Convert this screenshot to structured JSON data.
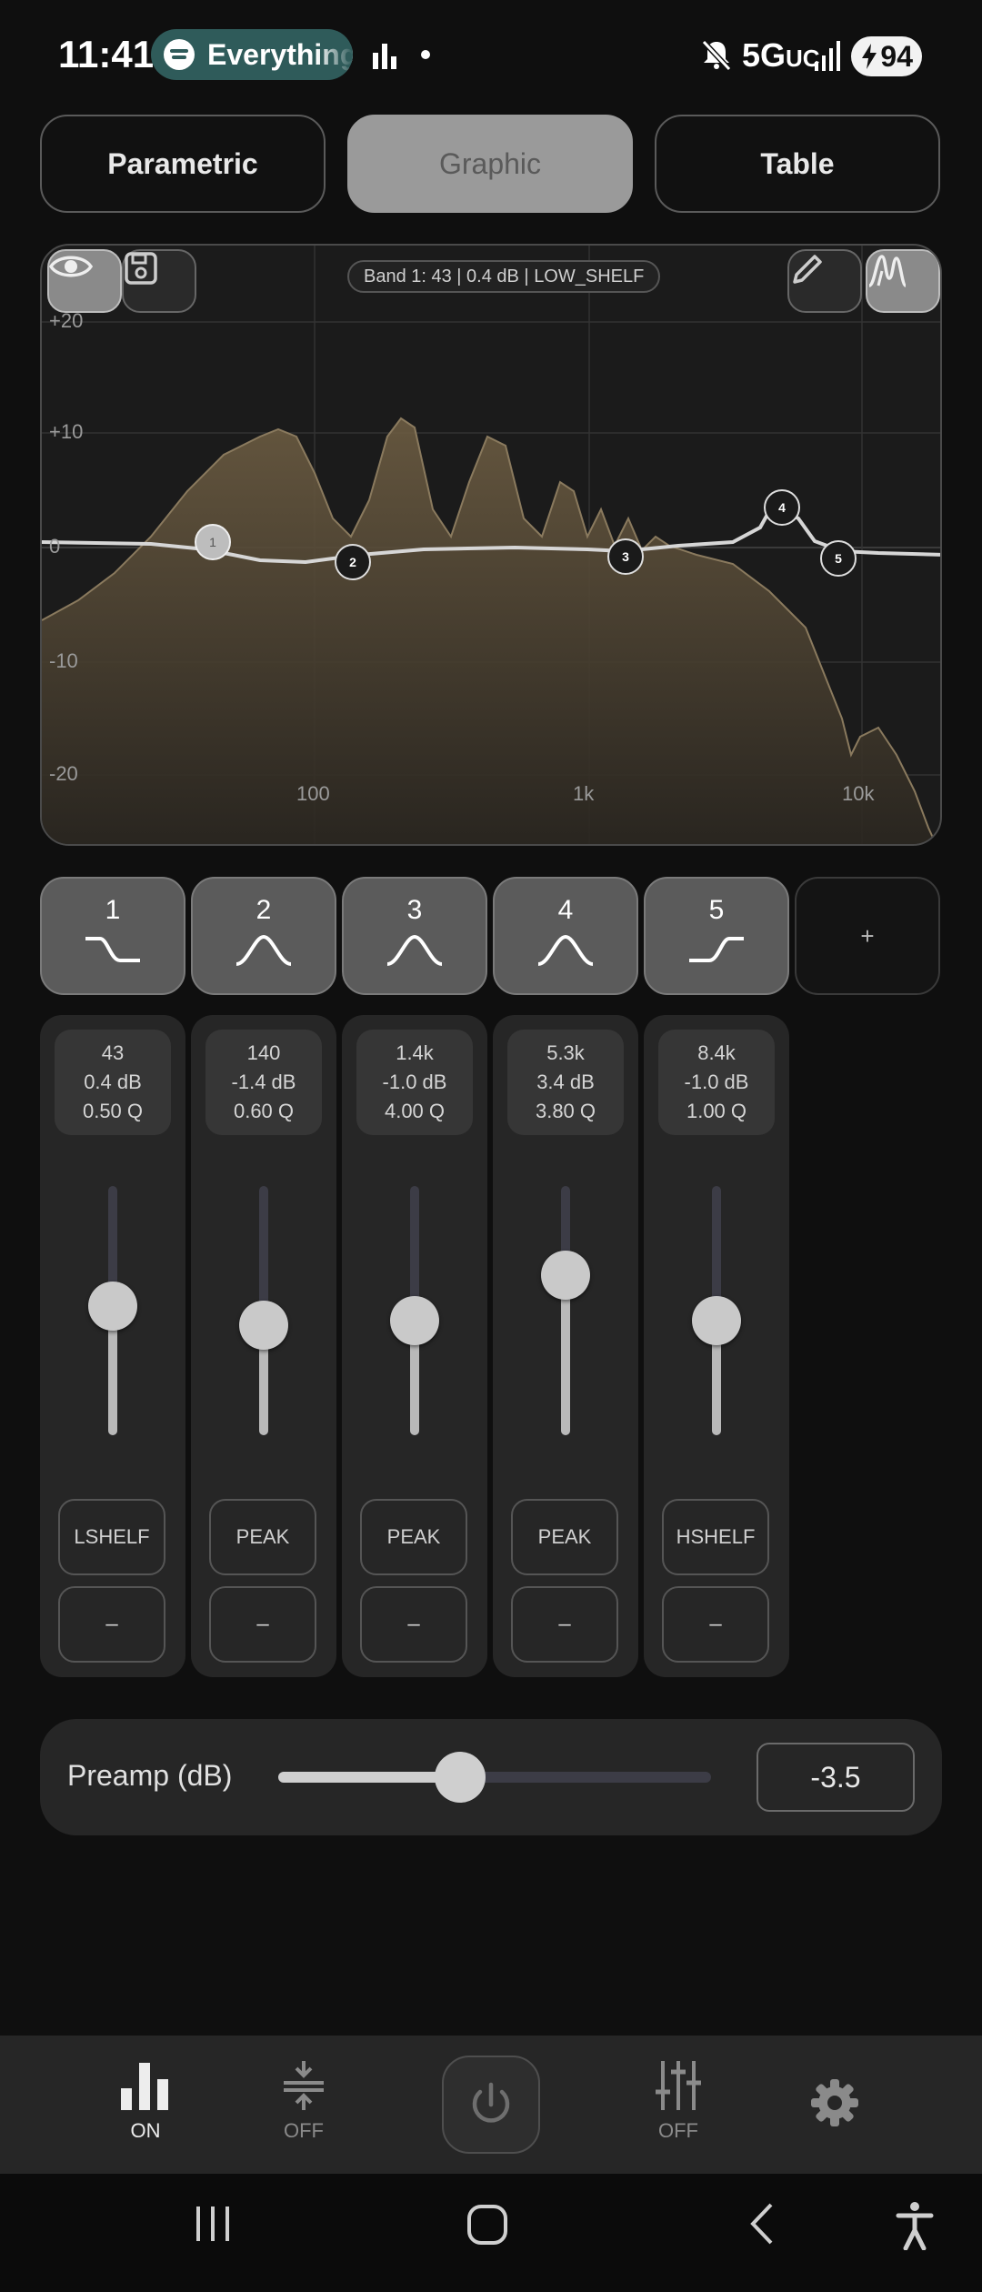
{
  "status_bar": {
    "time": "11:41",
    "now_playing": "Everything",
    "network": "5G",
    "network_suffix": "UC",
    "battery": "94",
    "icons": [
      "spotify-icon",
      "equalizer-status-icon",
      "notification-dot-icon",
      "mute-icon",
      "signal-icon",
      "battery-charging-icon"
    ]
  },
  "mode_tabs": [
    {
      "label": "Parametric",
      "active": false
    },
    {
      "label": "Graphic",
      "active": true
    },
    {
      "label": "Table",
      "active": false
    }
  ],
  "graph": {
    "band_info": "Band 1: 43 | 0.4 dB | LOW_SHELF",
    "y_labels": [
      "+20",
      "+10",
      "0",
      "-10",
      "-20"
    ],
    "x_labels": [
      "100",
      "1k",
      "10k"
    ],
    "buttons": [
      "eye-icon",
      "save-icon",
      "pencil-icon",
      "spectrum-icon"
    ],
    "colors": {
      "response_fill": "#5a4c38",
      "curve": "#d6d6d6",
      "grid": "#333333"
    }
  },
  "bands": [
    {
      "number": "1",
      "freq": "43",
      "gain": "0.4 dB",
      "q": "0.50 Q",
      "type": "LSHELF",
      "dash": "–",
      "shape": "low-shelf",
      "gain_db": 0.4
    },
    {
      "number": "2",
      "freq": "140",
      "gain": "-1.4 dB",
      "q": "0.60 Q",
      "type": "PEAK",
      "dash": "–",
      "shape": "peak",
      "gain_db": -1.4
    },
    {
      "number": "3",
      "freq": "1.4k",
      "gain": "-1.0 dB",
      "q": "4.00 Q",
      "type": "PEAK",
      "dash": "–",
      "shape": "peak",
      "gain_db": -1.0
    },
    {
      "number": "4",
      "freq": "5.3k",
      "gain": "3.4 dB",
      "q": "3.80 Q",
      "type": "PEAK",
      "dash": "–",
      "shape": "peak",
      "gain_db": 3.4
    },
    {
      "number": "5",
      "freq": "8.4k",
      "gain": "-1.0 dB",
      "q": "1.00 Q",
      "type": "HSHELF",
      "dash": "–",
      "shape": "high-shelf",
      "gain_db": -1.0
    }
  ],
  "add_band_label": "+",
  "preamp": {
    "label": "Preamp (dB)",
    "value": "-3.5",
    "fraction": 0.42
  },
  "bottom_bar": [
    {
      "icon": "equalizer-icon",
      "label": "ON",
      "active": true
    },
    {
      "icon": "compressor-icon",
      "label": "OFF",
      "active": false
    },
    {
      "icon": "power-icon",
      "label": "",
      "active": false
    },
    {
      "icon": "mixer-icon",
      "label": "OFF",
      "active": false
    },
    {
      "icon": "settings-icon",
      "label": "",
      "active": false
    }
  ],
  "nav_bar": [
    "recent-apps-icon",
    "home-icon",
    "back-icon",
    "accessibility-icon"
  ]
}
